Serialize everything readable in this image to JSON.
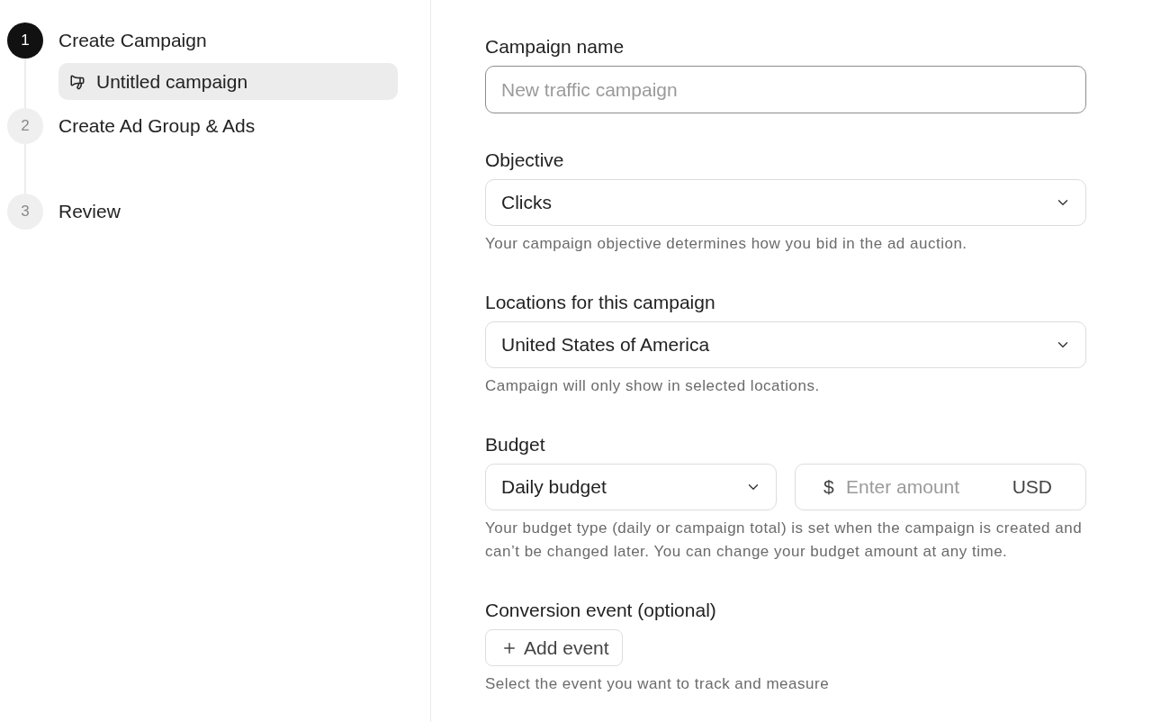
{
  "steps": [
    {
      "number": "1",
      "label": "Create Campaign",
      "selected": true,
      "children": [
        {
          "label": "Untitled campaign",
          "selected": true
        }
      ]
    },
    {
      "number": "2",
      "label": "Create Ad Group & Ads",
      "selected": false
    },
    {
      "number": "3",
      "label": "Review",
      "selected": false
    }
  ],
  "form": {
    "fields": [
      {
        "kind": "text",
        "label": "Campaign name",
        "placeholder": "New traffic campaign"
      },
      {
        "kind": "select",
        "label": "Objective",
        "value": "Clicks",
        "help": "Your campaign objective determines how you bid in the ad auction."
      },
      {
        "kind": "select",
        "label": "Locations for this campaign",
        "value": "United States of America",
        "help": "Campaign will only show in selected locations."
      },
      {
        "kind": "budget",
        "label": "Budget",
        "value": "Daily budget",
        "currency_symbol": "$",
        "placeholder": "Enter amount",
        "currency": "USD",
        "help": "Your budget type (daily or campaign total) is set when the campaign is created and can’t be changed later. You can change your budget amount at any time."
      },
      {
        "kind": "button",
        "label": "Conversion event (optional)",
        "button": "Add event",
        "help": "Select the event you want to track and measure"
      }
    ]
  }
}
